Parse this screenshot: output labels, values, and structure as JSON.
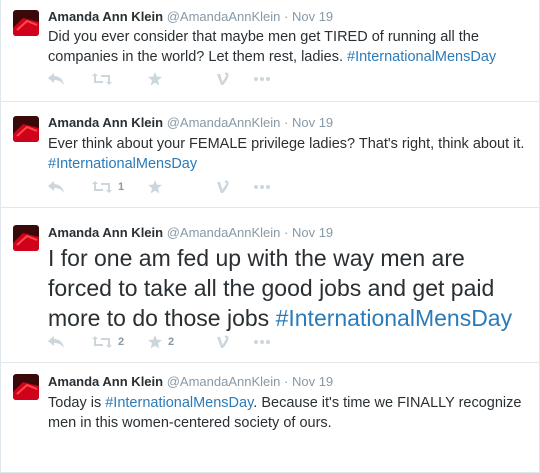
{
  "tweets": [
    {
      "fullname": "Amanda Ann Klein",
      "handle": "@AmandaAnnKlein",
      "separator": "·",
      "time": "Nov 19",
      "text_before": "Did you ever consider that maybe men get TIRED of running all the companies in the world? Let them rest, ladies. ",
      "hashtag": "#InternationalMensDay",
      "text_after": "",
      "retweets": "",
      "favorites": ""
    },
    {
      "fullname": "Amanda Ann Klein",
      "handle": "@AmandaAnnKlein",
      "separator": "·",
      "time": "Nov 19",
      "text_before": "Ever think about your FEMALE privilege ladies? That's right, think about it. ",
      "hashtag": "#InternationalMensDay",
      "text_after": "",
      "retweets": "1",
      "favorites": ""
    },
    {
      "fullname": "Amanda Ann Klein",
      "handle": "@AmandaAnnKlein",
      "separator": "·",
      "time": "Nov 19",
      "text_before": "I for one am fed up with the way men are forced to take all the good jobs and get paid more to do those jobs ",
      "hashtag": "#InternationalMensDay",
      "text_after": "",
      "retweets": "2",
      "favorites": "2"
    },
    {
      "fullname": "Amanda Ann Klein",
      "handle": "@AmandaAnnKlein",
      "separator": "·",
      "time": "Nov 19",
      "text_before": "Today is ",
      "hashtag": "#InternationalMensDay",
      "text_after": ". Because it's time we FINALLY recognize men in this women-centered society of ours.",
      "retweets": "",
      "favorites": ""
    }
  ],
  "icons": {
    "reply": "reply-icon",
    "retweet": "retweet-icon",
    "favorite": "star-icon",
    "vine": "vine-icon",
    "more": "more-icon"
  },
  "colors": {
    "hashtag": "#2b7bb9",
    "meta": "#8899a6",
    "action": "#ccd6dd",
    "divider": "#e1e8ed",
    "avatar": "#d0021b"
  }
}
